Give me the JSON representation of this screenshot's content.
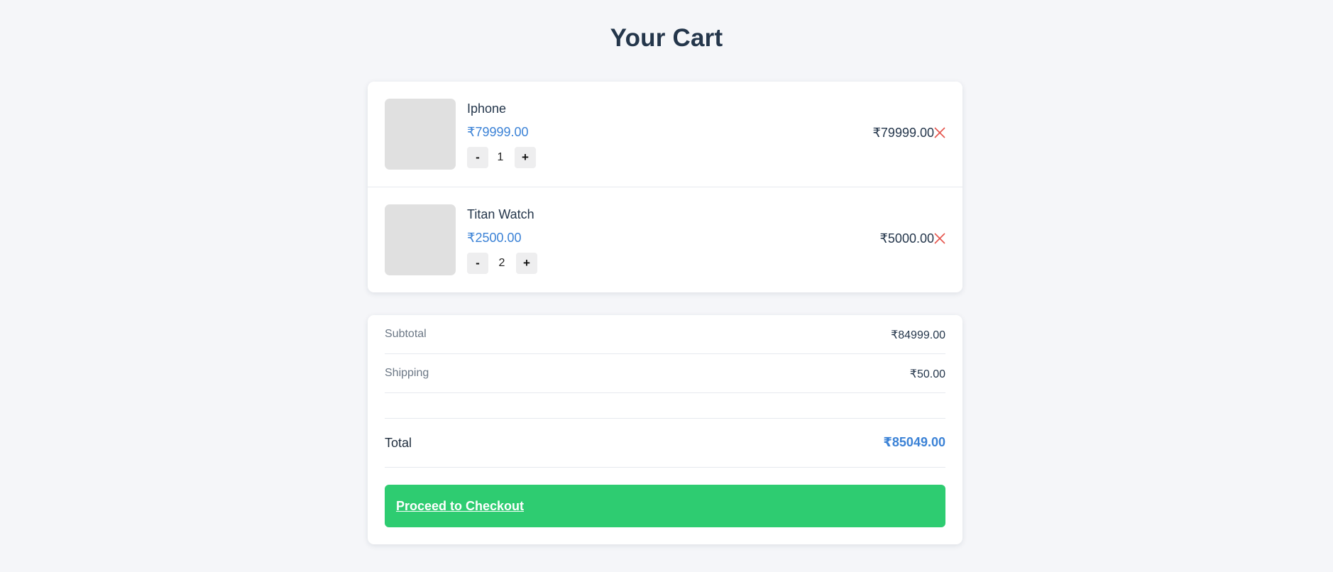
{
  "page": {
    "title": "Your Cart"
  },
  "cart": {
    "items": [
      {
        "name": "Iphone",
        "price": "₹79999.00",
        "quantity": "1",
        "line_total": "₹79999.00",
        "decrement_label": "-",
        "increment_label": "+",
        "image_icon": "product-image-placeholder",
        "remove_icon": "close-icon"
      },
      {
        "name": "Titan Watch",
        "price": "₹2500.00",
        "quantity": "2",
        "line_total": "₹5000.00",
        "decrement_label": "-",
        "increment_label": "+",
        "image_icon": "product-image-placeholder",
        "remove_icon": "close-icon"
      }
    ]
  },
  "summary": {
    "subtotal_label": "Subtotal",
    "subtotal_value": "₹84999.00",
    "shipping_label": "Shipping",
    "shipping_value": "₹50.00",
    "total_label": "Total",
    "total_value": "₹85049.00",
    "checkout_label": "Proceed to Checkout"
  },
  "colors": {
    "accent": "#3b82d6",
    "checkout": "#2ecc71",
    "remove": "#e5534b",
    "background": "#f5f6f9"
  }
}
